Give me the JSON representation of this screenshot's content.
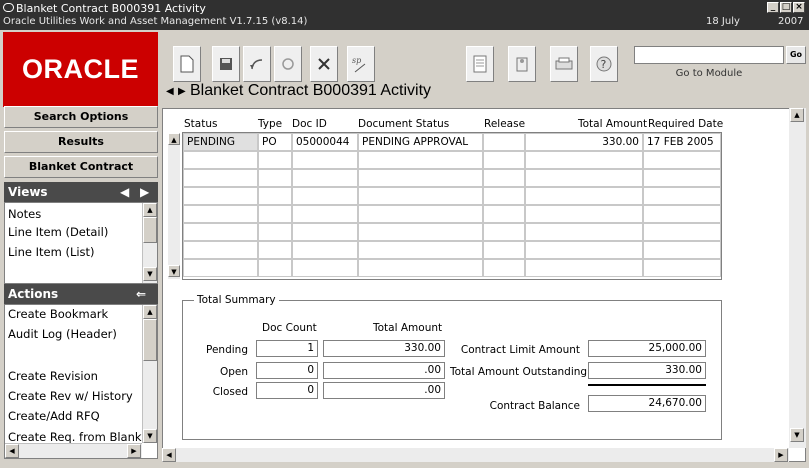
{
  "window": {
    "title": "Blanket Contract B000391 Activity",
    "subtitle": "Oracle Utilities Work and Asset Management V1.7.15 (v8.14)",
    "date_day": "18 July",
    "date_year": "2007",
    "min": "_",
    "max": "□",
    "close": "×"
  },
  "logo": "ORACLE",
  "toolbar": {
    "goto_label": "Go to Module",
    "go_label": "Go",
    "goto_value": ""
  },
  "page_title": "Blanket Contract B000391 Activity",
  "left_nav": {
    "search_options": "Search Options",
    "results": "Results",
    "blanket_contract": "Blanket Contract"
  },
  "views": {
    "title": "Views",
    "items": [
      "Notes",
      "Line Item (Detail)",
      "Line Item (List)"
    ]
  },
  "actions": {
    "title": "Actions",
    "items": [
      "Create Bookmark",
      "Audit Log (Header)",
      "",
      "Create Revision",
      "Create Rev w/ History",
      "Create/Add RFQ",
      "Create Req. from Blank"
    ]
  },
  "table": {
    "headers": [
      "Status",
      "Type",
      "Doc ID",
      "Document Status",
      "Release",
      "Total Amount",
      "Required Date"
    ],
    "rows": [
      [
        "PENDING",
        "PO",
        "05000044",
        "PENDING APPROVAL",
        "",
        "330.00",
        "17 FEB 2005"
      ]
    ]
  },
  "summary": {
    "legend": "Total Summary",
    "doc_count_header": "Doc Count",
    "total_amount_header": "Total Amount",
    "rows": [
      {
        "label": "Pending",
        "count": "1",
        "amount": "330.00"
      },
      {
        "label": "Open",
        "count": "0",
        "amount": ".00"
      },
      {
        "label": "Closed",
        "count": "0",
        "amount": ".00"
      }
    ],
    "contract_limit_label": "Contract Limit Amount",
    "contract_limit_value": "25,000.00",
    "outstanding_label": "Total Amount Outstanding",
    "outstanding_value": "330.00",
    "balance_label": "Contract Balance",
    "balance_value": "24,670.00"
  }
}
